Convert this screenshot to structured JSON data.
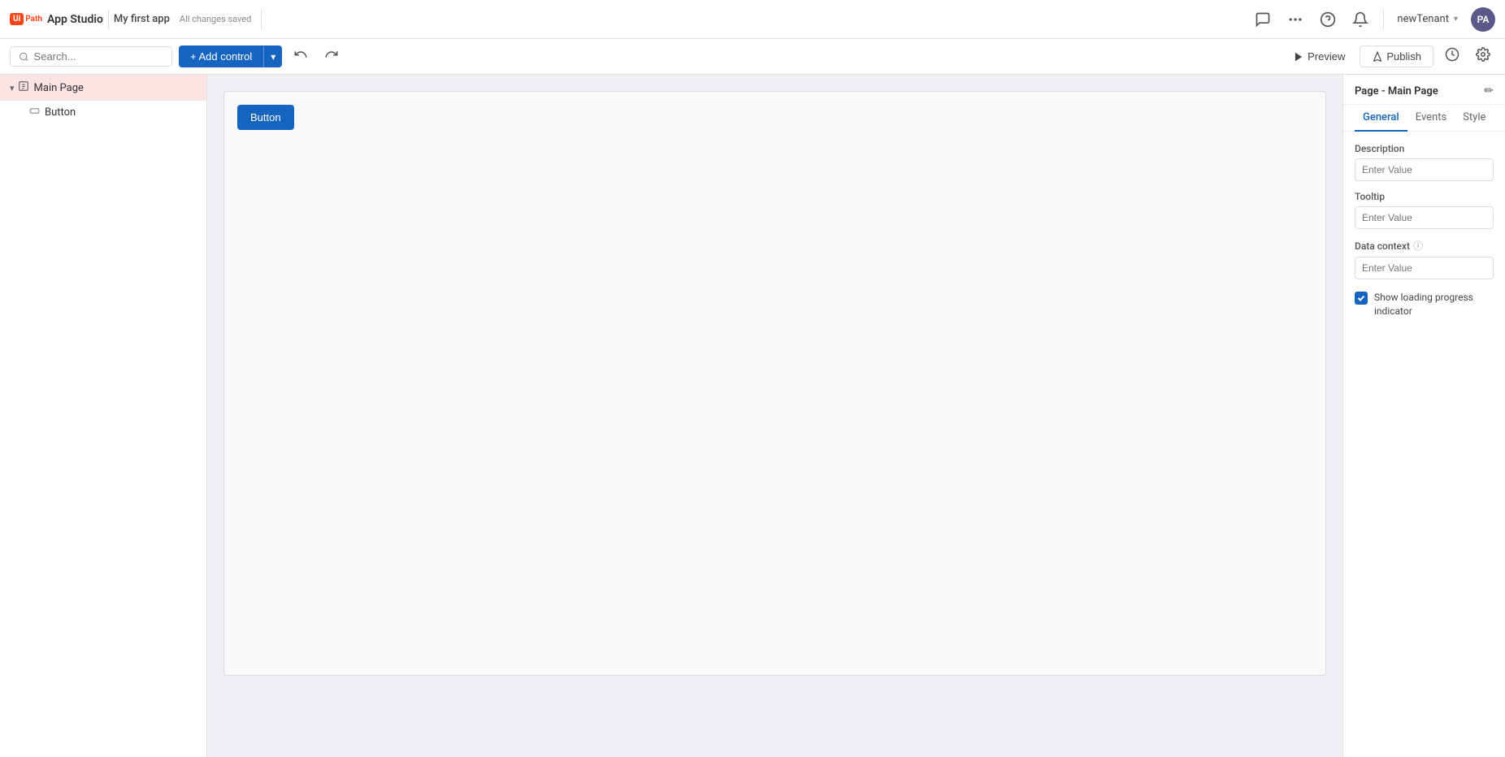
{
  "logo": {
    "ui_text": "Ui",
    "path_text": "Path",
    "studio_text": "App Studio"
  },
  "header": {
    "app_name": "My first app",
    "saved_status": "All changes saved"
  },
  "topbar": {
    "tenant": "newTenant",
    "avatar_initials": "PA"
  },
  "toolbar": {
    "search_placeholder": "Search...",
    "add_control_label": "+ Add control",
    "dropdown_arrow": "▾",
    "undo_label": "↩",
    "redo_label": "↪",
    "preview_label": "Preview",
    "publish_label": "Publish"
  },
  "sidebar": {
    "main_page_label": "Main Page",
    "button_label": "Button"
  },
  "canvas": {
    "button_label": "Button"
  },
  "right_panel": {
    "title": "Page - Main Page",
    "tabs": [
      "General",
      "Events",
      "Style"
    ],
    "active_tab": "General",
    "fields": {
      "description_label": "Description",
      "description_placeholder": "Enter Value",
      "tooltip_label": "Tooltip",
      "tooltip_placeholder": "Enter Value",
      "data_context_label": "Data context",
      "data_context_placeholder": "Enter Value"
    },
    "checkbox": {
      "label": "Show loading progress indicator",
      "checked": true
    }
  }
}
